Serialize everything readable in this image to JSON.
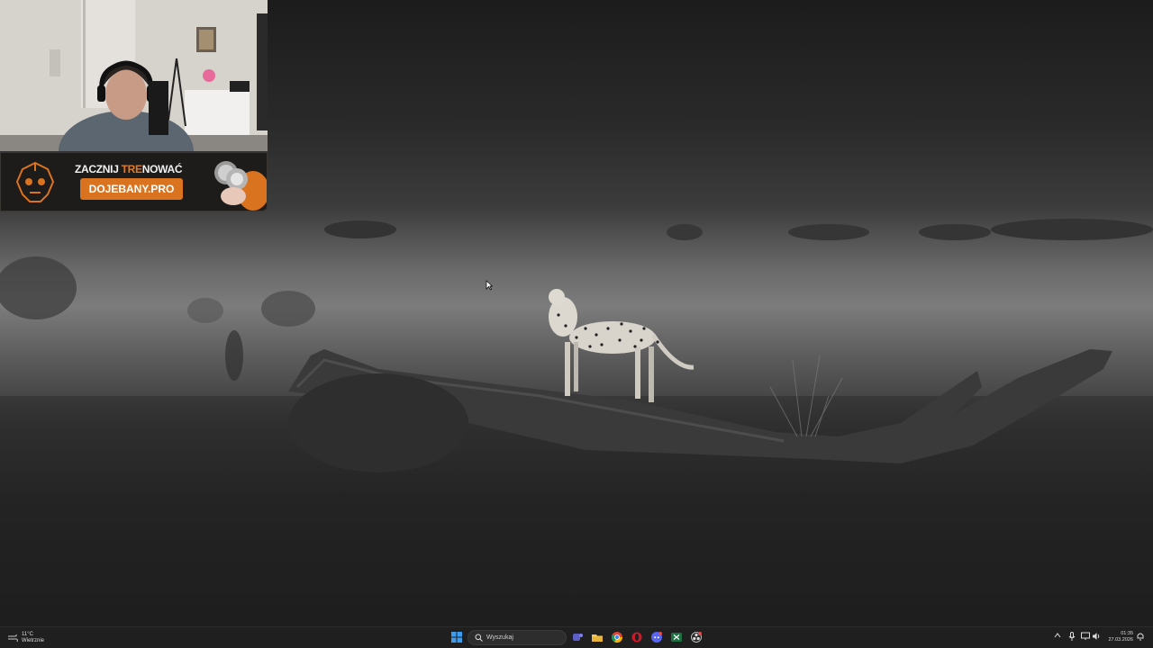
{
  "banner": {
    "title_part1": "ZACZNIJ ",
    "title_highlight": "TRE",
    "title_part2": "NOWAĆ",
    "url_label": "DOJEBANY.PRO"
  },
  "taskbar": {
    "weather": {
      "temperature": "11°C",
      "condition": "Wietrznie"
    },
    "search_placeholder": "Wyszukaj",
    "pinned_apps": [
      "start",
      "search",
      "teams",
      "file-explorer",
      "chrome",
      "opera",
      "discord",
      "excel",
      "obs"
    ],
    "clock": {
      "time": "01:35",
      "date": "27.03.2026"
    }
  },
  "colors": {
    "banner_accent": "#d9731f",
    "taskbar_bg": "#1f1f1f",
    "start_blue": "#3b9cf0"
  }
}
